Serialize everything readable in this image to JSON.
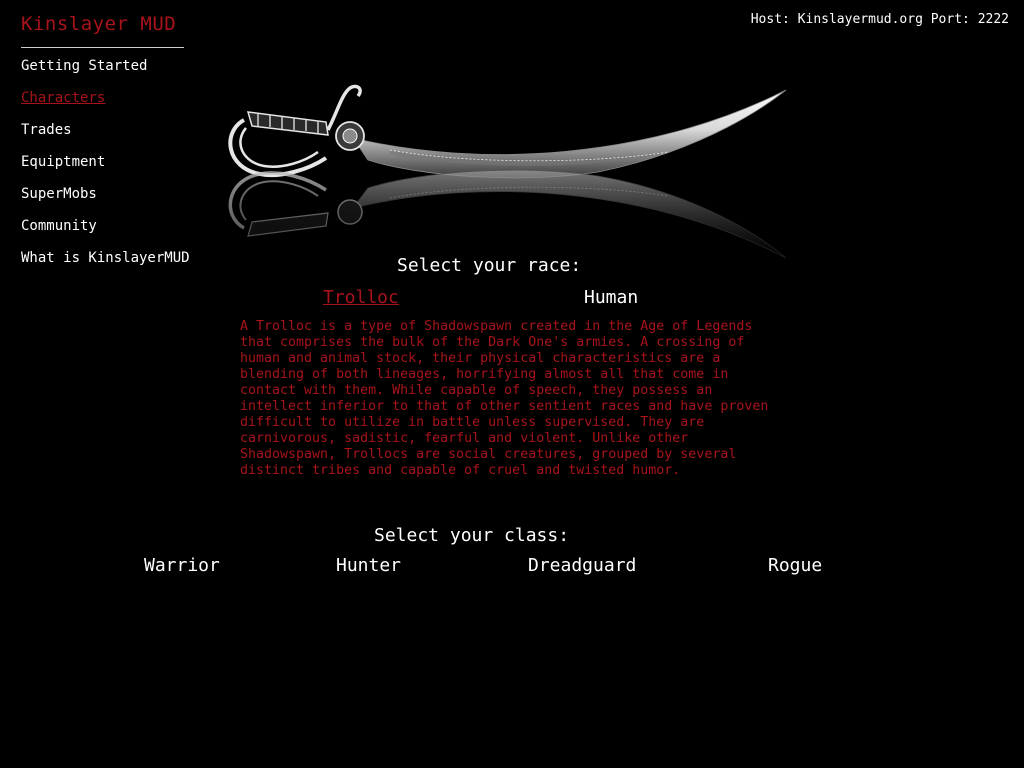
{
  "site": {
    "title": "Kinslayer MUD",
    "host_info": "Host: Kinslayermud.org Port: 2222"
  },
  "nav": {
    "items": [
      {
        "label": "Getting Started"
      },
      {
        "label": "Characters",
        "active": true
      },
      {
        "label": "Trades"
      },
      {
        "label": "Equiptment"
      },
      {
        "label": "SuperMobs"
      },
      {
        "label": "Community"
      },
      {
        "label": "What is KinslayerMUD"
      }
    ]
  },
  "race": {
    "heading": "Select your race:",
    "options": [
      {
        "label": "Trolloc",
        "selected": true
      },
      {
        "label": "Human"
      }
    ],
    "description": "A Trolloc is a type of Shadowspawn created in the Age of Legends that comprises the bulk of the Dark One's armies. A crossing of human and animal stock, their physical characteristics are a blending of both lineages, horrifying almost all that come in contact with them. While capable of speech, they possess an intellect inferior to that of other sentient races and have proven difficult to utilize in battle unless supervised. They are carnivorous, sadistic, fearful and violent. Unlike other Shadowspawn, Trollocs are social creatures, grouped by several distinct tribes and capable of cruel and twisted humor."
  },
  "class": {
    "heading": "Select your class:",
    "options": [
      {
        "label": "Warrior"
      },
      {
        "label": "Hunter"
      },
      {
        "label": "Dreadguard"
      },
      {
        "label": "Rogue"
      }
    ]
  },
  "colors": {
    "background": "#000000",
    "accent_red": "#a8131b",
    "text": "#ffffff"
  }
}
